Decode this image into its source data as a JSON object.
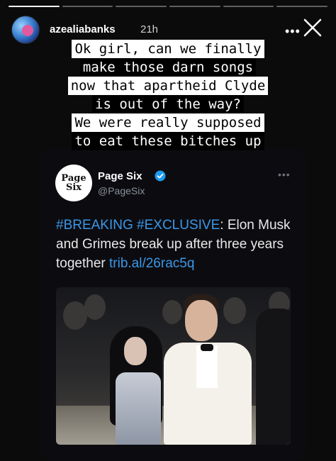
{
  "story": {
    "username": "azealiabanks",
    "time": "21h",
    "more_label": "•••",
    "progress": [
      1,
      0,
      0,
      0,
      0,
      0
    ],
    "caption_lines": [
      "Ok girl, can we finally",
      "make those darn songs",
      "now that apartheid Clyde",
      "is out of the way?",
      "We were really supposed",
      "to eat these bitches up"
    ]
  },
  "tweet": {
    "author_name": "Page Six",
    "handle": "@PageSix",
    "logo_line1": "Page",
    "logo_line2": "Six",
    "more_label": "•••",
    "tag1": "#BREAKING",
    "tag2": "#EXCLUSIVE",
    "text_part": ": Elon Musk and Grimes break up after three years together ",
    "link": "trib.al/26rac5q"
  },
  "colors": {
    "background": "#0b0b0c",
    "link_blue": "#3b97e8",
    "verified_blue": "#1d9bf0"
  }
}
